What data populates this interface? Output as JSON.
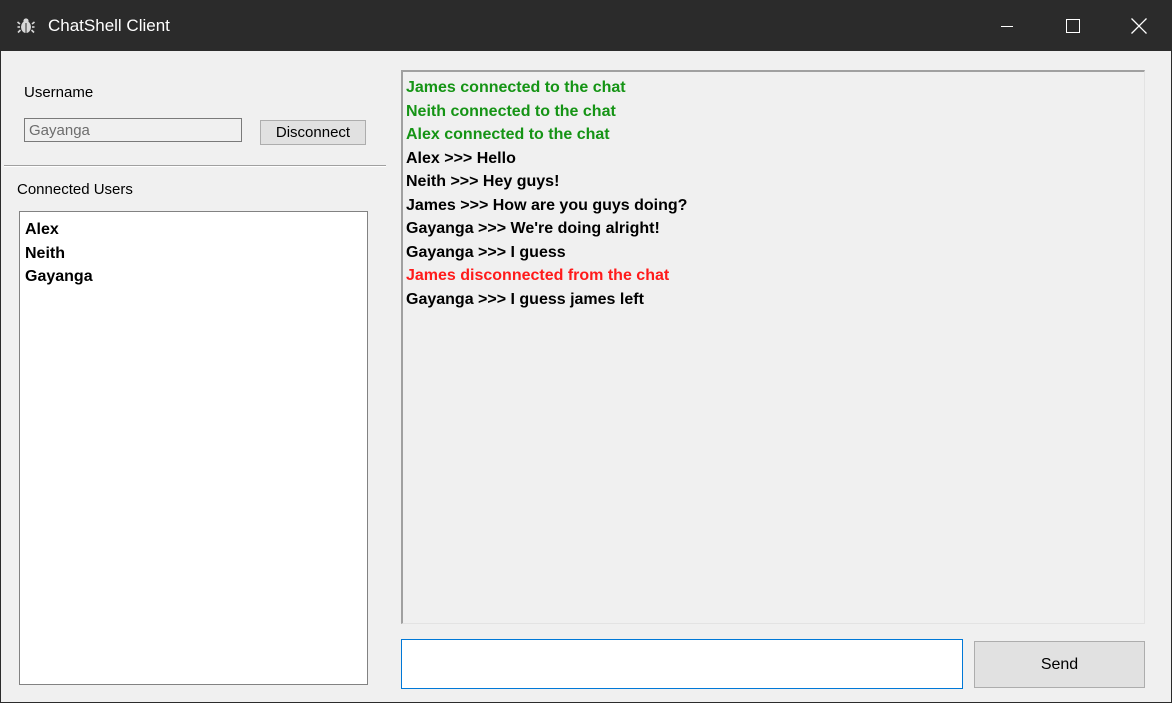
{
  "window": {
    "title": "ChatShell Client",
    "icon": "bug-icon",
    "controls": [
      "minimize-icon",
      "maximize-icon",
      "close-icon"
    ]
  },
  "login": {
    "username_label": "Username",
    "username_value": "Gayanga",
    "disconnect_label": "Disconnect"
  },
  "users": {
    "label": "Connected Users",
    "items": [
      "Alex",
      "Neith",
      "Gayanga"
    ]
  },
  "chat": {
    "messages": [
      {
        "text": "James connected to the chat",
        "kind": "join"
      },
      {
        "text": "Neith connected to the chat",
        "kind": "join"
      },
      {
        "text": "Alex connected to the chat",
        "kind": "join"
      },
      {
        "text": "Alex >>> Hello",
        "kind": "chat"
      },
      {
        "text": "Neith >>> Hey guys!",
        "kind": "chat"
      },
      {
        "text": "James >>> How are you guys doing?",
        "kind": "chat"
      },
      {
        "text": "Gayanga >>> We're doing alright!",
        "kind": "chat"
      },
      {
        "text": "Gayanga >>> I guess",
        "kind": "chat"
      },
      {
        "text": "James disconnected from the chat",
        "kind": "leave"
      },
      {
        "text": "Gayanga >>> I guess james left",
        "kind": "chat"
      }
    ],
    "input_value": "",
    "send_label": "Send"
  },
  "colors": {
    "titlebar": "#2b2b2b",
    "join": "#159415",
    "leave": "#ff1a1a",
    "chat": "#000000",
    "focus_border": "#0078d7"
  }
}
